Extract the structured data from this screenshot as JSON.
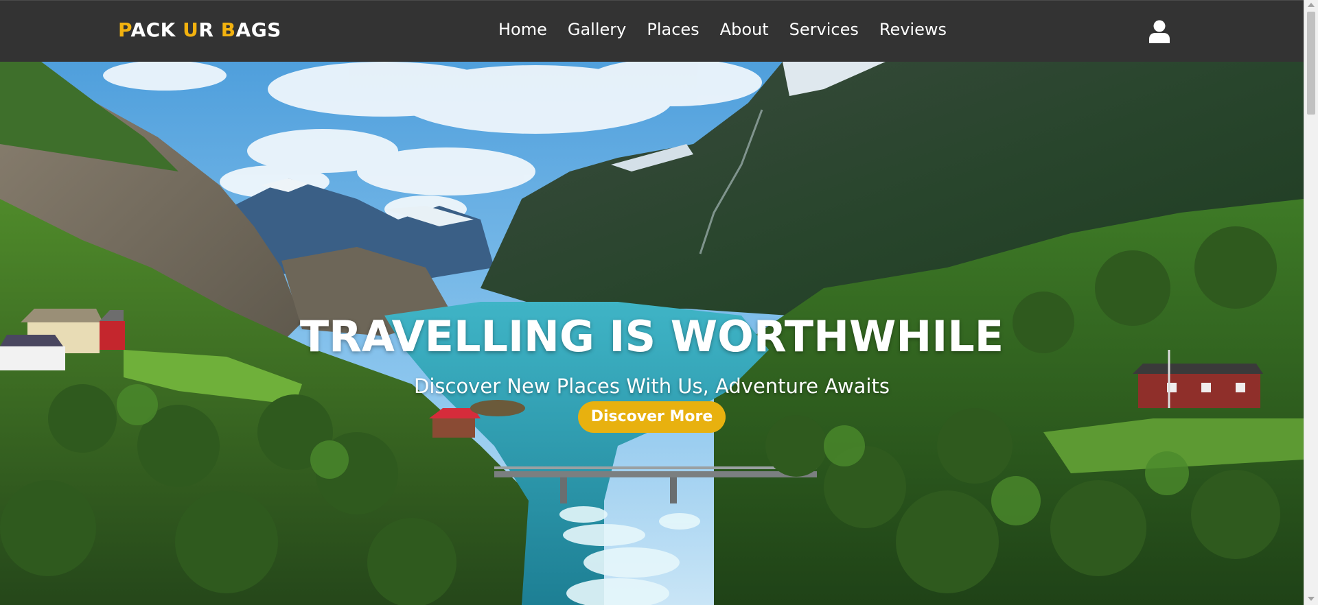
{
  "brand": {
    "letter_1": "P",
    "text_1": "ACK ",
    "letter_2": "U",
    "text_2": "R ",
    "letter_3": "B",
    "text_3": "AGS",
    "accent_color": "#f2b20f"
  },
  "nav": {
    "items": [
      {
        "label": "Home"
      },
      {
        "label": "Gallery"
      },
      {
        "label": "Places"
      },
      {
        "label": "About"
      },
      {
        "label": "Services"
      },
      {
        "label": "Reviews"
      }
    ],
    "user_icon": "user-icon"
  },
  "hero": {
    "title": "TRAVELLING IS WORTHWHILE",
    "subtitle": "Discover New Places With Us, Adventure Awaits",
    "cta_label": "Discover More",
    "cta_color": "#e8b10f",
    "background": "mountain-fjord-river-landscape"
  },
  "colors": {
    "navbar": "#333333",
    "text": "#ffffff"
  }
}
